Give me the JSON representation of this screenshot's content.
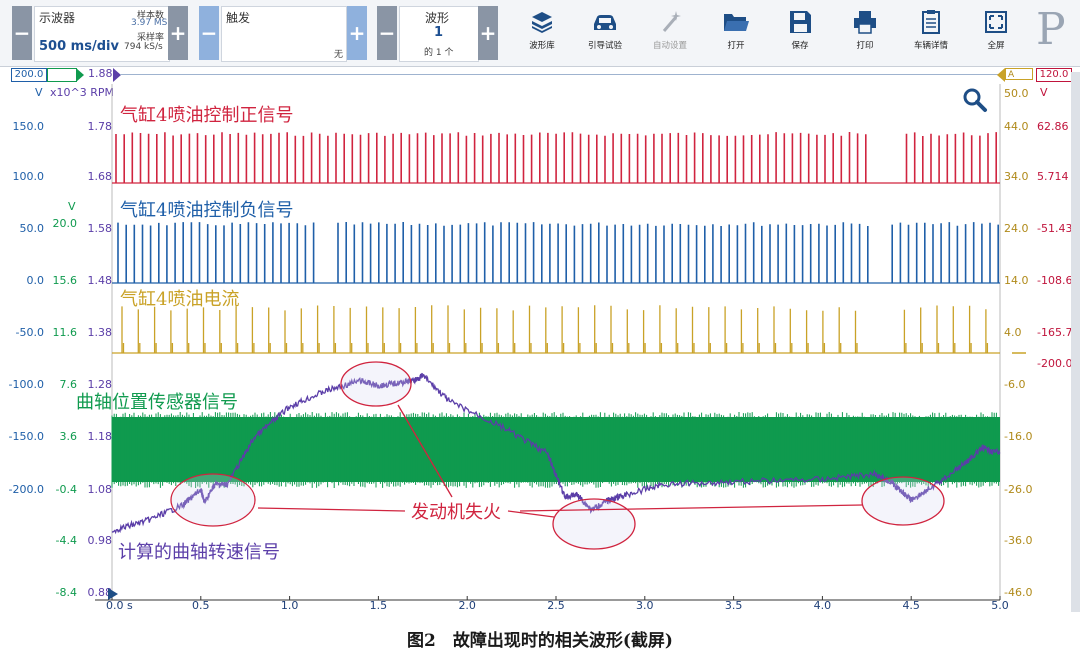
{
  "toolbar": {
    "scope_label": "示波器",
    "timebase": "500 ms/div",
    "samples_label": "样本数",
    "samples_value": "3.97 MS",
    "rate_label": "采样率",
    "rate_value": "794 kS/s",
    "trigger_label": "触发",
    "trigger_value": "无",
    "waveform_label": "波形",
    "waveform_num": "1",
    "waveform_count": "的 1 个",
    "buttons": [
      {
        "label": "波形库",
        "icon": "library-icon"
      },
      {
        "label": "引导试验",
        "icon": "car-icon"
      },
      {
        "label": "自动设置",
        "icon": "wand-icon",
        "disabled": true
      },
      {
        "label": "打开",
        "icon": "folder-icon"
      },
      {
        "label": "保存",
        "icon": "save-icon"
      },
      {
        "label": "打印",
        "icon": "printer-icon"
      },
      {
        "label": "车辆详情",
        "icon": "clipboard-icon"
      },
      {
        "label": "全屏",
        "icon": "fullscreen-icon"
      }
    ],
    "logo": "P"
  },
  "scale_bar": {
    "left_max": "200.0",
    "left_mid": "1.88",
    "right_tag": "A",
    "right_max": "120.0"
  },
  "units": {
    "col1": "V",
    "col2": "x10^3 RPM",
    "col3_top": "V",
    "right1": "50.0",
    "right2": "V"
  },
  "axes": {
    "col1_values": [
      "150.0",
      "100.0",
      "50.0",
      "0.0",
      "-50.0",
      "-100.0",
      "-150.0",
      "-200.0"
    ],
    "col2_values": [
      "20.0",
      "15.6",
      "11.6",
      "7.6",
      "3.6",
      "-0.4",
      "-4.4",
      "-8.4"
    ],
    "col3_values": [
      "1.78",
      "1.68",
      "1.58",
      "1.48",
      "1.38",
      "1.28",
      "1.18",
      "1.08",
      "0.98",
      "0.88"
    ],
    "right1_values": [
      "44.0",
      "34.0",
      "24.0",
      "14.0",
      "4.0",
      "-6.0",
      "-16.0",
      "-26.0",
      "-36.0",
      "-46.0"
    ],
    "right2_values": [
      "62.86",
      "5.714",
      "-51.43",
      "-108.6",
      "-165.7",
      "-200.0"
    ]
  },
  "channel_titles": {
    "ch_a": "气缸4喷油控制正信号",
    "ch_b": "气缸4喷油控制负信号",
    "ch_c": "气缸4喷油电流",
    "ch_d": "曲轴位置传感器信号",
    "ch_e": "计算的曲轴转速信号",
    "misfire": "发动机失火"
  },
  "colors": {
    "ch_a": "#d0243f",
    "ch_b": "#1f5fa8",
    "ch_c": "#c9a227",
    "ch_d": "#0f9a4e",
    "ch_e": "#5b3ea8",
    "col1_axis": "#1f5fa8",
    "col2_axis": "#0f9a4e",
    "col3_axis": "#5b3ea8",
    "right1_axis": "#b08a1a",
    "right2_axis": "#c0143c",
    "misfire_line": "#d0243f"
  },
  "chart_data": {
    "type": "line",
    "xlim": [
      0.0,
      5.0
    ],
    "x_ticks": [
      "0.0 s",
      "0.5",
      "1.0",
      "1.5",
      "2.0",
      "2.5",
      "3.0",
      "3.5",
      "4.0",
      "4.5",
      "5.0"
    ],
    "series": [
      {
        "name": "计算的曲轴转速信号",
        "x": [
          0,
          0.2,
          0.4,
          0.5,
          0.52,
          0.58,
          0.65,
          0.8,
          1.0,
          1.2,
          1.4,
          1.5,
          1.6,
          1.7,
          1.75,
          1.9,
          2.2,
          2.45,
          2.55,
          2.62,
          2.7,
          2.8,
          2.9,
          3.1,
          3.5,
          4.0,
          4.3,
          4.4,
          4.45,
          4.5,
          4.6,
          4.8,
          4.9,
          5.0
        ],
        "y": [
          1.0,
          1.02,
          1.05,
          1.08,
          1.055,
          1.09,
          1.09,
          1.18,
          1.24,
          1.27,
          1.29,
          1.28,
          1.285,
          1.29,
          1.3,
          1.25,
          1.2,
          1.15,
          1.065,
          1.07,
          1.04,
          1.06,
          1.07,
          1.09,
          1.095,
          1.1,
          1.11,
          1.09,
          1.075,
          1.06,
          1.08,
          1.13,
          1.16,
          1.15
        ]
      }
    ],
    "misfire_markers_x": [
      0.52,
      2.62,
      4.48
    ]
  },
  "caption": "图2　故障出现时的相关波形(截屏)"
}
